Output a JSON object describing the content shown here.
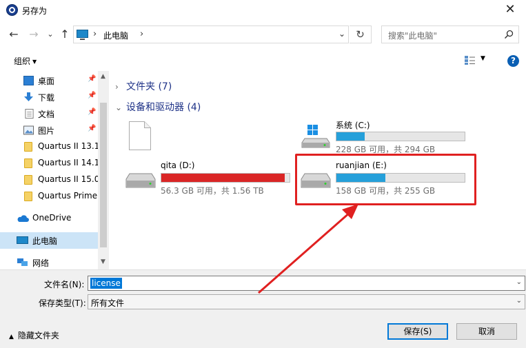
{
  "window": {
    "title": "另存为",
    "close_glyph": "✕"
  },
  "nav": {
    "back_glyph": "←",
    "forward_glyph": "→",
    "recent_glyph": "⌄",
    "up_glyph": "↑",
    "path_sep": "›",
    "path": "此电脑",
    "refresh_glyph": "↻",
    "search_placeholder": "搜索\"此电脑\""
  },
  "toolbar": {
    "organize_label": "组织",
    "help_label": "?"
  },
  "sidebar": {
    "items": [
      {
        "label": "桌面",
        "icon": "desktop-icon"
      },
      {
        "label": "下载",
        "icon": "download-icon"
      },
      {
        "label": "文档",
        "icon": "document-icon"
      },
      {
        "label": "图片",
        "icon": "picture-icon"
      },
      {
        "label": "Quartus II 13.1",
        "icon": "folder-icon"
      },
      {
        "label": "Quartus II 14.1",
        "icon": "folder-icon"
      },
      {
        "label": "Quartus II 15.0",
        "icon": "folder-icon"
      },
      {
        "label": "Quartus Prime",
        "icon": "folder-icon"
      },
      {
        "label": "OneDrive",
        "icon": "cloud-icon"
      },
      {
        "label": "此电脑",
        "icon": "computer-icon"
      },
      {
        "label": "网络",
        "icon": "network-icon"
      }
    ]
  },
  "main": {
    "folders_group": "文件夹 (7)",
    "devices_group": "设备和驱动器 (4)",
    "drives": [
      {
        "name": "系统 (C:)",
        "space": "228 GB 可用，共 294 GB",
        "used_fraction": 0.22,
        "color": "#26a0da"
      },
      {
        "name": "qita (D:)",
        "space": "56.3 GB 可用，共 1.56 TB",
        "used_fraction": 0.96,
        "color": "#da2626"
      },
      {
        "name": "ruanjian (E:)",
        "space": "158 GB 可用，共 255 GB",
        "used_fraction": 0.38,
        "color": "#26a0da"
      }
    ]
  },
  "form": {
    "filename_label": "文件名(N):",
    "filename_value": "license",
    "filetype_label": "保存类型(T):",
    "filetype_value": "所有文件",
    "hide_folders_label": "隐藏文件夹",
    "save_label": "保存(S)",
    "cancel_label": "取消"
  },
  "colors": {
    "accent": "#0078d7",
    "annotation": "#e02020"
  }
}
